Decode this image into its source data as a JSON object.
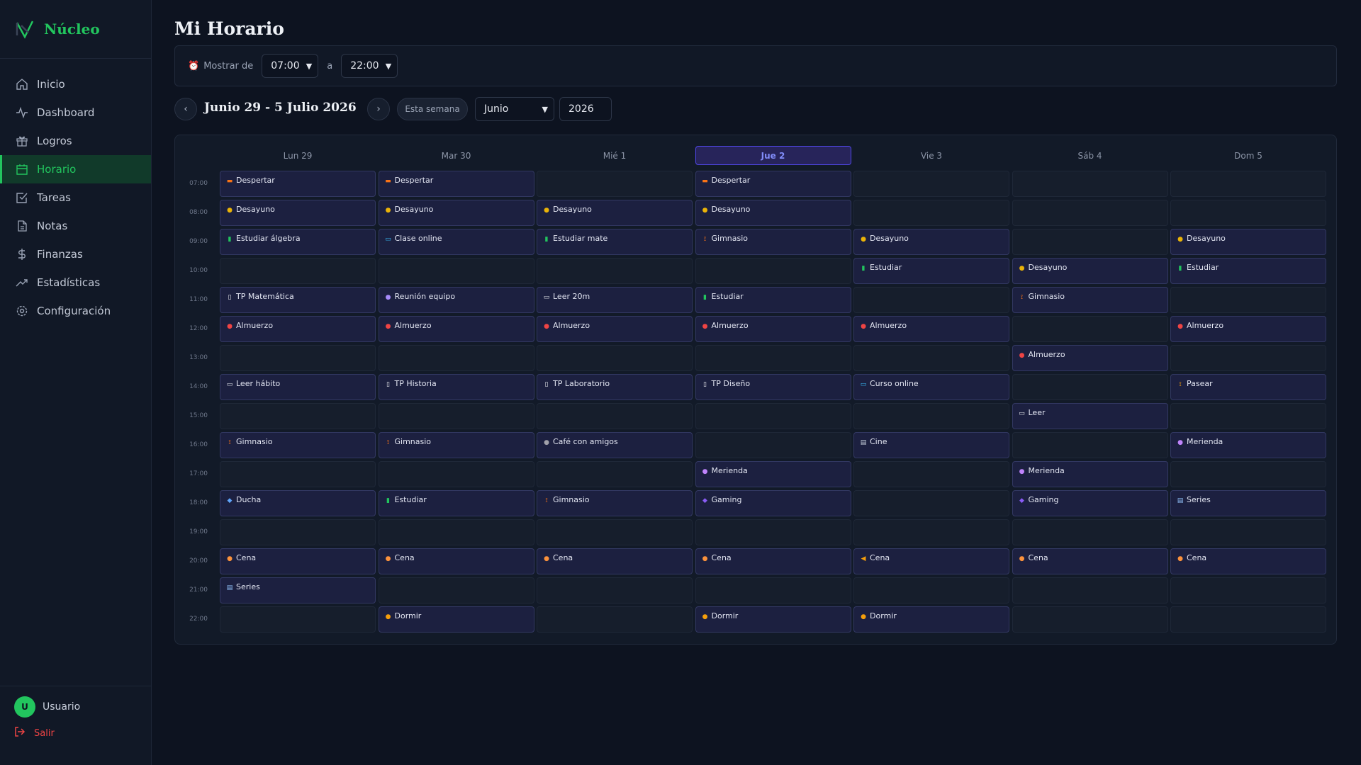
{
  "app": {
    "name": "Núcleo"
  },
  "sidebar": {
    "items": [
      {
        "label": "Inicio",
        "icon": "home-icon",
        "active": false
      },
      {
        "label": "Dashboard",
        "icon": "activity-icon",
        "active": false
      },
      {
        "label": "Logros",
        "icon": "gift-icon",
        "active": false
      },
      {
        "label": "Horario",
        "icon": "calendar-icon",
        "active": true
      },
      {
        "label": "Tareas",
        "icon": "check-square-icon",
        "active": false
      },
      {
        "label": "Notas",
        "icon": "file-icon",
        "active": false
      },
      {
        "label": "Finanzas",
        "icon": "dollar-icon",
        "active": false
      },
      {
        "label": "Estadísticas",
        "icon": "trending-up-icon",
        "active": false
      },
      {
        "label": "Configuración",
        "icon": "gear-icon",
        "active": false
      }
    ],
    "user": {
      "initial": "U",
      "name": "Usuario"
    },
    "logout_label": "Salir"
  },
  "page": {
    "title": "Mi Horario"
  },
  "range": {
    "label": "Mostrar de",
    "from": "07:00",
    "separator": "a",
    "to": "22:00"
  },
  "week_nav": {
    "prev": "‹",
    "next": "›",
    "title": "Junio 29 - 5 Julio 2026",
    "this_week": "Esta semana",
    "month": "Junio",
    "year": "2026"
  },
  "colors": {
    "accent": "#22c55e",
    "today": "#818cf8",
    "event_bg": "#1c2040",
    "danger": "#ef4444"
  },
  "calendar": {
    "days": [
      {
        "label": "Lun 29",
        "today": false
      },
      {
        "label": "Mar 30",
        "today": false
      },
      {
        "label": "Mié 1",
        "today": false
      },
      {
        "label": "Jue 2",
        "today": true
      },
      {
        "label": "Vie 3",
        "today": false
      },
      {
        "label": "Sáb 4",
        "today": false
      },
      {
        "label": "Dom 5",
        "today": false
      }
    ],
    "hours": [
      "07:00",
      "08:00",
      "09:00",
      "10:00",
      "11:00",
      "12:00",
      "13:00",
      "14:00",
      "15:00",
      "16:00",
      "17:00",
      "18:00",
      "19:00",
      "20:00",
      "21:00",
      "22:00"
    ],
    "events": [
      {
        "day": 0,
        "hour": 0,
        "label": "Despertar",
        "icon": "sunrise-icon"
      },
      {
        "day": 1,
        "hour": 0,
        "label": "Despertar",
        "icon": "sunrise-icon"
      },
      {
        "day": 3,
        "hour": 0,
        "label": "Despertar",
        "icon": "sunrise-icon"
      },
      {
        "day": 0,
        "hour": 1,
        "label": "Desayuno",
        "icon": "breakfast-icon"
      },
      {
        "day": 1,
        "hour": 1,
        "label": "Desayuno",
        "icon": "breakfast-icon"
      },
      {
        "day": 2,
        "hour": 1,
        "label": "Desayuno",
        "icon": "breakfast-icon"
      },
      {
        "day": 3,
        "hour": 1,
        "label": "Desayuno",
        "icon": "breakfast-icon"
      },
      {
        "day": 0,
        "hour": 2,
        "label": "Estudiar álgebra",
        "icon": "books-icon"
      },
      {
        "day": 1,
        "hour": 2,
        "label": "Clase online",
        "icon": "laptop-icon"
      },
      {
        "day": 2,
        "hour": 2,
        "label": "Estudiar mate",
        "icon": "books-icon"
      },
      {
        "day": 3,
        "hour": 2,
        "label": "Gimnasio",
        "icon": "weight-icon"
      },
      {
        "day": 4,
        "hour": 2,
        "label": "Desayuno",
        "icon": "breakfast-icon"
      },
      {
        "day": 6,
        "hour": 2,
        "label": "Desayuno",
        "icon": "breakfast-icon"
      },
      {
        "day": 4,
        "hour": 3,
        "label": "Estudiar",
        "icon": "books-icon"
      },
      {
        "day": 5,
        "hour": 3,
        "label": "Desayuno",
        "icon": "breakfast-icon"
      },
      {
        "day": 6,
        "hour": 3,
        "label": "Estudiar",
        "icon": "books-icon"
      },
      {
        "day": 0,
        "hour": 4,
        "label": "TP Matemática",
        "icon": "document-icon"
      },
      {
        "day": 1,
        "hour": 4,
        "label": "Reunión equipo",
        "icon": "meeting-icon"
      },
      {
        "day": 2,
        "hour": 4,
        "label": "Leer 20m",
        "icon": "book-icon"
      },
      {
        "day": 3,
        "hour": 4,
        "label": "Estudiar",
        "icon": "books-icon"
      },
      {
        "day": 5,
        "hour": 4,
        "label": "Gimnasio",
        "icon": "weight-icon"
      },
      {
        "day": 0,
        "hour": 5,
        "label": "Almuerzo",
        "icon": "lunch-icon"
      },
      {
        "day": 1,
        "hour": 5,
        "label": "Almuerzo",
        "icon": "lunch-icon"
      },
      {
        "day": 2,
        "hour": 5,
        "label": "Almuerzo",
        "icon": "lunch-icon"
      },
      {
        "day": 3,
        "hour": 5,
        "label": "Almuerzo",
        "icon": "lunch-icon"
      },
      {
        "day": 4,
        "hour": 5,
        "label": "Almuerzo",
        "icon": "lunch-icon"
      },
      {
        "day": 6,
        "hour": 5,
        "label": "Almuerzo",
        "icon": "lunch-icon"
      },
      {
        "day": 5,
        "hour": 6,
        "label": "Almuerzo",
        "icon": "lunch-icon"
      },
      {
        "day": 0,
        "hour": 7,
        "label": "Leer hábito",
        "icon": "book-icon"
      },
      {
        "day": 1,
        "hour": 7,
        "label": "TP Historia",
        "icon": "document-icon"
      },
      {
        "day": 2,
        "hour": 7,
        "label": "TP Laboratorio",
        "icon": "document-icon"
      },
      {
        "day": 3,
        "hour": 7,
        "label": "TP Diseño",
        "icon": "document-icon"
      },
      {
        "day": 4,
        "hour": 7,
        "label": "Curso online",
        "icon": "laptop-icon"
      },
      {
        "day": 6,
        "hour": 7,
        "label": "Pasear",
        "icon": "walk-icon"
      },
      {
        "day": 5,
        "hour": 8,
        "label": "Leer",
        "icon": "book-icon"
      },
      {
        "day": 0,
        "hour": 9,
        "label": "Gimnasio",
        "icon": "weight-icon"
      },
      {
        "day": 1,
        "hour": 9,
        "label": "Gimnasio",
        "icon": "weight-icon"
      },
      {
        "day": 2,
        "hour": 9,
        "label": "Café con amigos",
        "icon": "coffee-icon"
      },
      {
        "day": 4,
        "hour": 9,
        "label": "Cine",
        "icon": "film-icon"
      },
      {
        "day": 6,
        "hour": 9,
        "label": "Merienda",
        "icon": "snack-icon"
      },
      {
        "day": 3,
        "hour": 10,
        "label": "Merienda",
        "icon": "snack-icon"
      },
      {
        "day": 5,
        "hour": 10,
        "label": "Merienda",
        "icon": "snack-icon"
      },
      {
        "day": 0,
        "hour": 11,
        "label": "Ducha",
        "icon": "shower-icon"
      },
      {
        "day": 1,
        "hour": 11,
        "label": "Estudiar",
        "icon": "books-icon"
      },
      {
        "day": 2,
        "hour": 11,
        "label": "Gimnasio",
        "icon": "weight-icon"
      },
      {
        "day": 3,
        "hour": 11,
        "label": "Gaming",
        "icon": "gamepad-icon"
      },
      {
        "day": 5,
        "hour": 11,
        "label": "Gaming",
        "icon": "gamepad-icon"
      },
      {
        "day": 6,
        "hour": 11,
        "label": "Series",
        "icon": "tv-icon"
      },
      {
        "day": 0,
        "hour": 13,
        "label": "Cena",
        "icon": "dinner-icon"
      },
      {
        "day": 1,
        "hour": 13,
        "label": "Cena",
        "icon": "dinner-icon"
      },
      {
        "day": 2,
        "hour": 13,
        "label": "Cena",
        "icon": "dinner-icon"
      },
      {
        "day": 3,
        "hour": 13,
        "label": "Cena",
        "icon": "dinner-icon"
      },
      {
        "day": 4,
        "hour": 13,
        "label": "Cena",
        "icon": "pizza-icon"
      },
      {
        "day": 5,
        "hour": 13,
        "label": "Cena",
        "icon": "dinner-icon"
      },
      {
        "day": 6,
        "hour": 13,
        "label": "Cena",
        "icon": "dinner-icon"
      },
      {
        "day": 0,
        "hour": 14,
        "label": "Series",
        "icon": "tv-icon"
      },
      {
        "day": 1,
        "hour": 15,
        "label": "Dormir",
        "icon": "sleep-icon"
      },
      {
        "day": 3,
        "hour": 15,
        "label": "Dormir",
        "icon": "sleep-icon"
      },
      {
        "day": 4,
        "hour": 15,
        "label": "Dormir",
        "icon": "sleep-icon"
      }
    ]
  }
}
